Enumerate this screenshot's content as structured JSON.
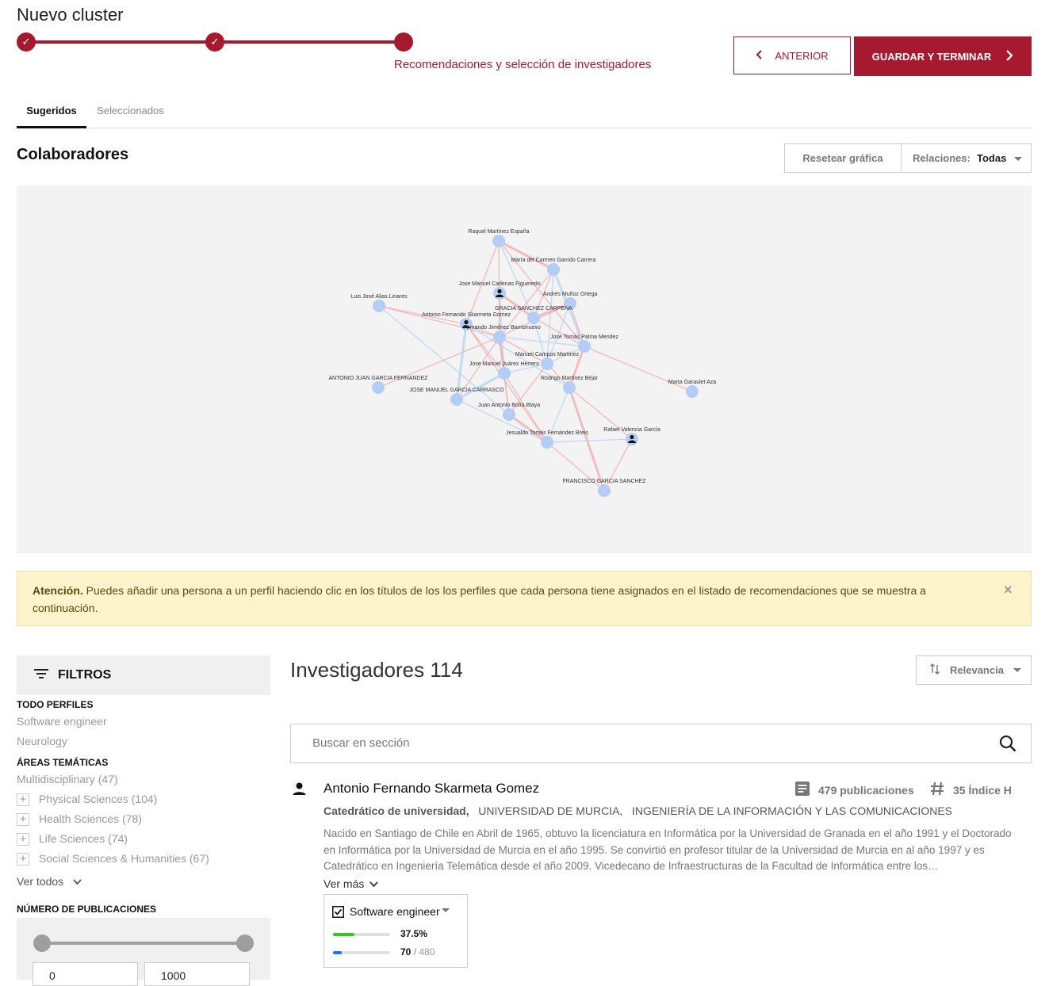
{
  "header": {
    "title": "Nuevo cluster",
    "step_label": "Recomendaciones y selección de investigadores",
    "prev_label": "ANTERIOR",
    "save_label": "GUARDAR Y TERMINAR"
  },
  "tabs": [
    {
      "label": "Sugeridos",
      "active": true
    },
    {
      "label": "Seleccionados",
      "active": false
    }
  ],
  "graph_section": {
    "title": "Colaboradores",
    "reset_label": "Resetear gráfica",
    "relations_label": "Relaciones:",
    "relations_value": "Todas"
  },
  "graph_nodes": [
    {
      "id": "rme",
      "label": "Raquel Martínez España",
      "user": false
    },
    {
      "id": "mcg",
      "label": "María del Carmen Garrido Carrera",
      "user": false
    },
    {
      "id": "jmc",
      "label": "Jose Manuel Cadenas Figueredo",
      "user": true
    },
    {
      "id": "amo",
      "label": "Andrés Muñoz Ortega",
      "user": false
    },
    {
      "id": "lja",
      "label": "Luis José Alias Linares",
      "user": false
    },
    {
      "id": "gsc",
      "label": "GRACIA SANCHEZ CARPENA",
      "user": false
    },
    {
      "id": "afs",
      "label": "Antonio Fernando Skarmeta Gomez",
      "user": true
    },
    {
      "id": "fjb",
      "label": "Fernando Jiménez Barrionuevo",
      "user": false
    },
    {
      "id": "jtp",
      "label": "Jose Tomás Palma Mendez",
      "user": false
    },
    {
      "id": "mcm",
      "label": "Manuel Campos Martínez",
      "user": false
    },
    {
      "id": "jmj",
      "label": "Jose Manuel Juárez Herrero",
      "user": false
    },
    {
      "id": "ajg",
      "label": "ANTONIO JUAN GARCIA FERNANDEZ",
      "user": false
    },
    {
      "id": "rmb",
      "label": "Rodrigo Martínez Béjar",
      "user": false
    },
    {
      "id": "mga",
      "label": "Marta Garaulet Aza",
      "user": false
    },
    {
      "id": "jmgc",
      "label": "JOSE MANUEL GARCIA CARRASCO",
      "user": false
    },
    {
      "id": "jab",
      "label": "Juan Antonio Botía Blaya",
      "user": false
    },
    {
      "id": "jtf",
      "label": "Jesualdo Tomás Fernández Breis",
      "user": false
    },
    {
      "id": "rvg",
      "label": "Rafael Valencia García",
      "user": true
    },
    {
      "id": "fgs",
      "label": "FRANCISCO GARCIA SANCHEZ",
      "user": false
    }
  ],
  "graph_edges": [
    [
      "rme",
      "mcg"
    ],
    [
      "rme",
      "fjb"
    ],
    [
      "rme",
      "gsc"
    ],
    [
      "rme",
      "jtp"
    ],
    [
      "rme",
      "afs"
    ],
    [
      "mcg",
      "jtp"
    ],
    [
      "mcg",
      "gsc"
    ],
    [
      "mcg",
      "fjb"
    ],
    [
      "mcg",
      "mcm"
    ],
    [
      "jmc",
      "fjb"
    ],
    [
      "jmc",
      "gsc"
    ],
    [
      "jmc",
      "jmj"
    ],
    [
      "amo",
      "fjb"
    ],
    [
      "amo",
      "jtp"
    ],
    [
      "amo",
      "mcm"
    ],
    [
      "amo",
      "gsc"
    ],
    [
      "lja",
      "afs"
    ],
    [
      "lja",
      "jab"
    ],
    [
      "lja",
      "fjb"
    ],
    [
      "afs",
      "fjb"
    ],
    [
      "afs",
      "jmgc"
    ],
    [
      "afs",
      "jtf"
    ],
    [
      "afs",
      "jmj"
    ],
    [
      "afs",
      "rmb"
    ],
    [
      "fjb",
      "mcm"
    ],
    [
      "fjb",
      "jmj"
    ],
    [
      "fjb",
      "jtp"
    ],
    [
      "fjb",
      "jmgc"
    ],
    [
      "fjb",
      "jab"
    ],
    [
      "jtp",
      "mcm"
    ],
    [
      "jtp",
      "rmb"
    ],
    [
      "jtp",
      "mga"
    ],
    [
      "mcm",
      "jmj"
    ],
    [
      "mcm",
      "rmb"
    ],
    [
      "mcm",
      "jab"
    ],
    [
      "jmj",
      "jmgc"
    ],
    [
      "jmj",
      "jab"
    ],
    [
      "jmj",
      "jtf"
    ],
    [
      "rmb",
      "jtf"
    ],
    [
      "rmb",
      "rvg"
    ],
    [
      "rmb",
      "fgs"
    ],
    [
      "jtf",
      "rvg"
    ],
    [
      "jtf",
      "fgs"
    ],
    [
      "rvg",
      "fgs"
    ],
    [
      "jmgc",
      "jtf"
    ],
    [
      "jab",
      "jtf"
    ],
    [
      "gsc",
      "jtp"
    ],
    [
      "gsc",
      "mcm"
    ],
    [
      "ajg",
      "fjb"
    ]
  ],
  "alert": {
    "strong": "Atención.",
    "text": " Puedes añadir una persona a un perfil haciendo clic en los títulos de los los perfiles que cada persona tiene asignados en el listado de recomendaciones que se muestra a continuación.",
    "close": "×"
  },
  "filters": {
    "title": "FILTROS",
    "todo_perfiles": "TODO PERFILES",
    "profiles": [
      "Software engineer",
      "Neurology"
    ],
    "areas_title": "ÁREAS TEMÁTICAS",
    "areas": [
      {
        "label": "Multidisciplinary",
        "count": "(47)",
        "expandable": false
      },
      {
        "label": "Physical Sciences",
        "count": "(104)",
        "expandable": true
      },
      {
        "label": "Health Sciences",
        "count": "(78)",
        "expandable": true
      },
      {
        "label": "Life Sciences",
        "count": "(74)",
        "expandable": true
      },
      {
        "label": "Social Sciences & Humanities",
        "count": "(67)",
        "expandable": true
      }
    ],
    "ver_todos": "Ver todos",
    "num_pub_title": "NÚMERO DE PUBLICACIONES",
    "min": "0",
    "max": "1000"
  },
  "results": {
    "title": "Investigadores",
    "count": "114",
    "sort_label": "Relevancia",
    "search_placeholder": "Buscar en sección"
  },
  "person": {
    "name": "Antonio Fernando Skarmeta Gomez",
    "publications": "479 publicaciones",
    "h_index": "35 Índice H",
    "role": "Catedrático de universidad,",
    "university": "UNIVERSIDAD DE MURCIA,",
    "department": "INGENIERÍA DE LA INFORMACIÓN Y LAS COMUNICACIONES",
    "bio": "Nacido en Santiago de Chile en Abril de 1965, obtuvo la licenciatura en Informática por la Universidad de Granada en el año 1991 y el Doctorado en Informática por la Universidad de Murcia en el año 1995. Se convirtió en profesor titular de la Universidad de Murcia en al año 1997 y es Catedrático en Ingeniería Telemática desde el año 2009. Vicedecano de Infraestructuras de la Facultad de Informática entre los…",
    "ver_mas": "Ver más",
    "profile": {
      "name": "Software engineer",
      "checked": true,
      "percent": "37.5%",
      "percent_value": 0.375,
      "count": "70",
      "total": "480",
      "count_value": 70,
      "total_value": 480
    }
  },
  "colors": {
    "brand": "#a6192e",
    "node": "#b3cdf5",
    "edge_red": "#f1aab0",
    "edge_blue": "#b9d0f2",
    "green": "#2ecc1a",
    "blue": "#1a73e8"
  }
}
